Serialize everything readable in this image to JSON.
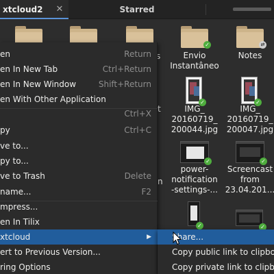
{
  "tabs": [
    {
      "label": "xtcloud2",
      "active": true
    },
    {
      "label": "Starred",
      "active": false
    },
    {
      "label": "",
      "active": false
    }
  ],
  "tab_close_glyph": "✕",
  "files": [
    {
      "label": "",
      "type": "folder"
    },
    {
      "label": "",
      "type": "folder"
    },
    {
      "label": "",
      "type": "folder"
    },
    {
      "label": "Envio\nInstantâneo",
      "type": "folder",
      "emblem": "ok"
    },
    {
      "label": "Notes",
      "type": "folder",
      "emblem": "share"
    },
    {
      "label": "IMG_\n20160719_\n200044.jpg",
      "type": "image",
      "emblem": "ok"
    },
    {
      "label": "IMG_\n20160719_\n200047.jpg",
      "type": "image",
      "emblem": "ok"
    },
    {
      "label": "power-\nnotification\n-settings-...",
      "type": "screenshot",
      "emblem": "ok"
    },
    {
      "label": "Screencast\nfrom\n23.04.201...",
      "type": "screenshot",
      "emblem": "ok"
    },
    {
      "label": "",
      "type": "screenshot",
      "emblem": "ok"
    },
    {
      "label": "",
      "type": "screenshot",
      "emblem": "ok"
    }
  ],
  "partial_labels": {
    "s": "s",
    "t": "t",
    "n": "n"
  },
  "context_menu": {
    "items": [
      {
        "label": "en",
        "accel": "Return"
      },
      {
        "label": "en In New Tab",
        "accel": "Ctrl+Return"
      },
      {
        "label": "en In New Window",
        "accel": "Shift+Return"
      },
      {
        "label": "en With Other Application",
        "accel": ""
      },
      {
        "label": "",
        "accel": "Ctrl+X"
      },
      {
        "label": "py",
        "accel": "Ctrl+C"
      },
      {
        "label": "ve to...",
        "accel": ""
      },
      {
        "label": "py to...",
        "accel": ""
      },
      {
        "label": "ve to Trash",
        "accel": "Delete"
      },
      {
        "label": "name...",
        "accel": "F2"
      },
      {
        "label": "mpress...",
        "accel": ""
      },
      {
        "label": "en In Tilix",
        "accel": ""
      },
      {
        "label": "xtcloud",
        "accel": "",
        "submenu_arrow": "▶",
        "selected": true
      },
      {
        "label": "ert to Previous Version...",
        "accel": ""
      },
      {
        "label": "ring Options",
        "accel": ""
      }
    ]
  },
  "submenu": {
    "items": [
      {
        "label": "Share...",
        "selected": true
      },
      {
        "label": "Copy public link to clipboard",
        "selected": false
      },
      {
        "label": "Copy private link to clipboard",
        "selected": false
      }
    ]
  },
  "colors": {
    "selection": "#215d9c",
    "folder": "#d9c19a",
    "emblem_ok": "#4fae3e"
  }
}
